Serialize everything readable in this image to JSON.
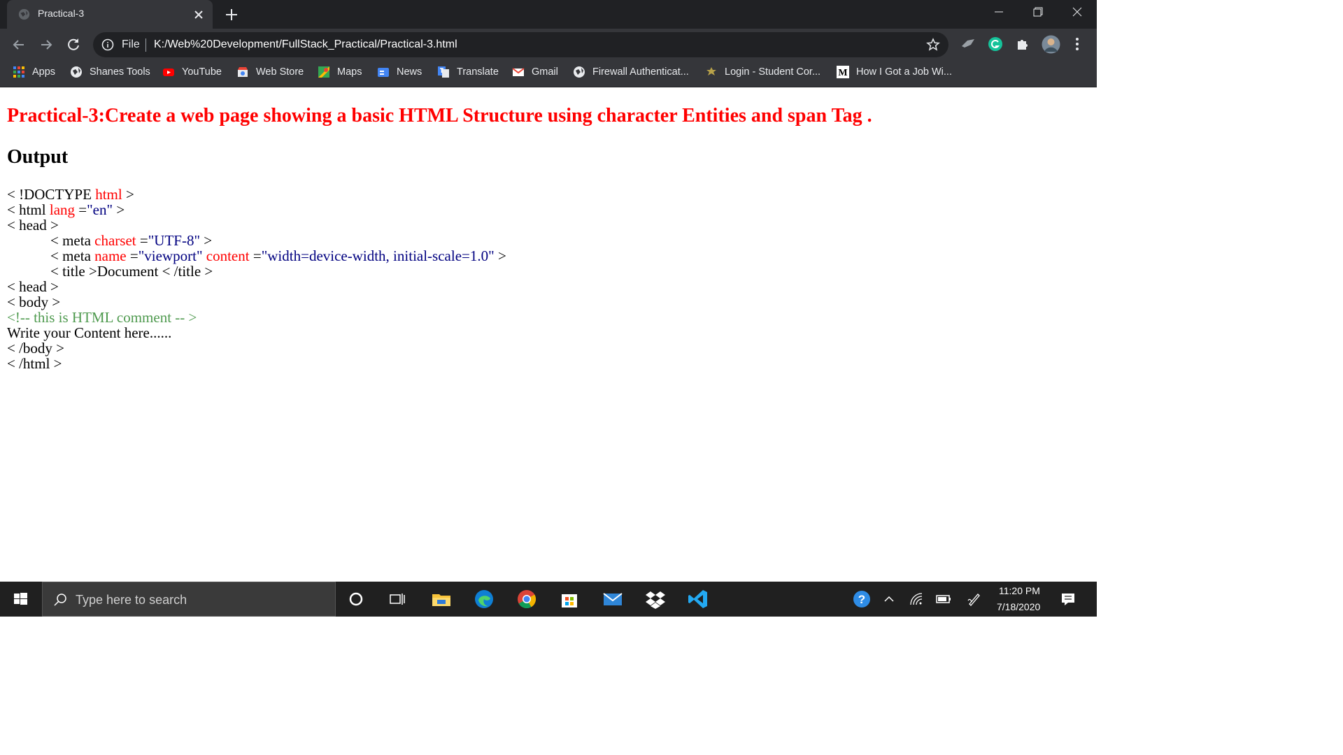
{
  "browser": {
    "tab": {
      "title": "Practical-3"
    },
    "omnibox": {
      "scheme_label": "File",
      "url": "K:/Web%20Development/FullStack_Practical/Practical-3.html"
    },
    "bookmarks": [
      {
        "label": "Apps",
        "icon": "apps-grid-icon"
      },
      {
        "label": "Shanes Tools",
        "icon": "globe-icon"
      },
      {
        "label": "YouTube",
        "icon": "youtube-icon"
      },
      {
        "label": "Web Store",
        "icon": "web-store-icon"
      },
      {
        "label": "Maps",
        "icon": "maps-icon"
      },
      {
        "label": "News",
        "icon": "news-icon"
      },
      {
        "label": "Translate",
        "icon": "translate-icon"
      },
      {
        "label": "Gmail",
        "icon": "gmail-icon"
      },
      {
        "label": "Firewall Authenticat...",
        "icon": "globe-icon"
      },
      {
        "label": "Login - Student Cor...",
        "icon": "login-icon"
      },
      {
        "label": "How I Got a Job Wi...",
        "icon": "medium-icon"
      }
    ]
  },
  "page": {
    "heading": "Practical-3:Create a web page showing a basic HTML Structure using character Entities and span Tag .",
    "output_title": "Output",
    "code": {
      "l1": {
        "a": "< !DOCTYPE ",
        "b": "html",
        "c": " >"
      },
      "l2": {
        "a": "< html ",
        "b": "lang",
        "c": " =",
        "d": "\"en\"",
        "e": " >"
      },
      "l3": "< head >",
      "l4": {
        "a": "< meta ",
        "b": "charset",
        "c": " =",
        "d": "\"UTF-8\"",
        "e": " >"
      },
      "l5": {
        "a": "< meta ",
        "b": "name",
        "c": " =",
        "d": "\"viewport\"",
        "e": " ",
        "f": "content",
        "g": " =",
        "h": "\"width=device-width, initial-scale=1.0\"",
        "i": " >"
      },
      "l6": "< title >Document < /title >",
      "l7": "< head >",
      "l8": "< body >",
      "l9": "<!-- this is HTML comment -- >",
      "l10": "Write your Content here......",
      "l11": "< /body >",
      "l12": "< /html >"
    }
  },
  "taskbar": {
    "search_placeholder": "Type here to search",
    "time": "11:20 PM",
    "date": "7/18/2020"
  },
  "colors": {
    "heading": "#ff0000",
    "attribute": "#ff0000",
    "value": "#000080",
    "comment": "#4f9a4f"
  }
}
